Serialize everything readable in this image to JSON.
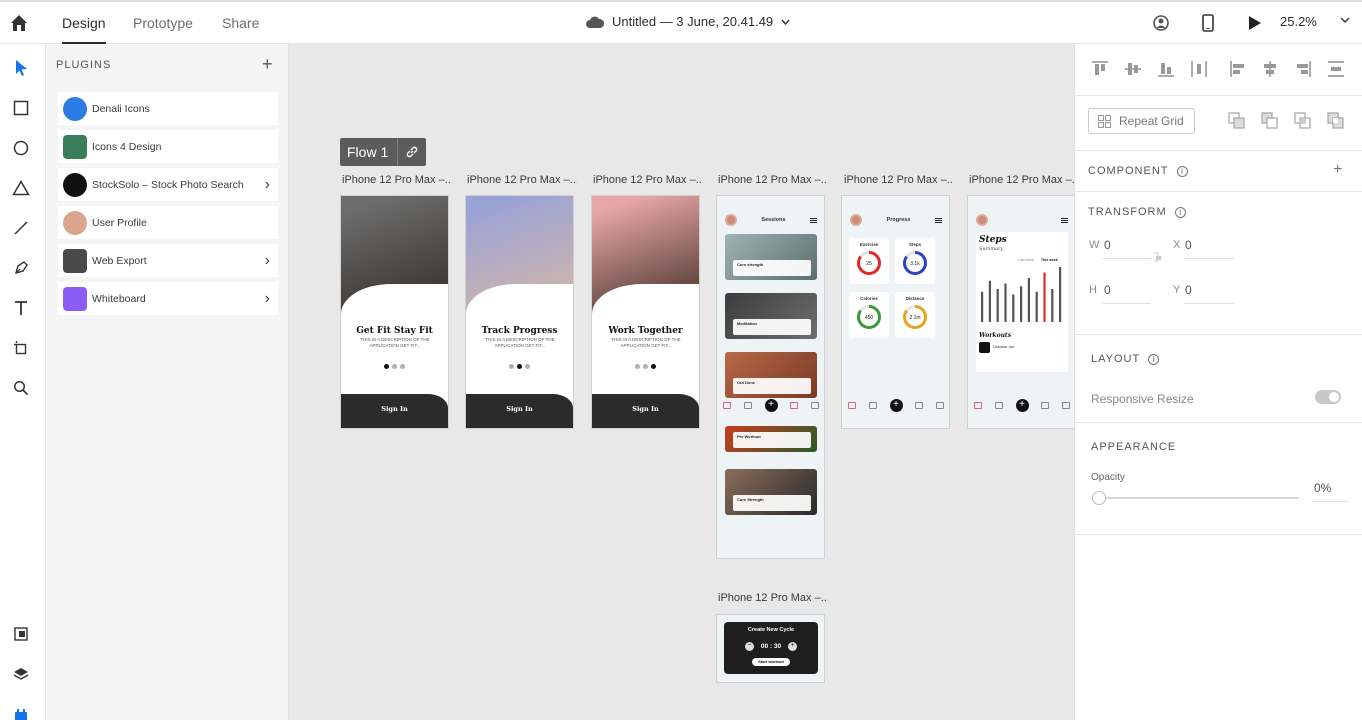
{
  "topbar": {
    "tabs": [
      {
        "label": "Design",
        "active": true
      },
      {
        "label": "Prototype",
        "active": false
      },
      {
        "label": "Share",
        "active": false
      }
    ],
    "doc_title": "Untitled — 3 June, 20.41.49",
    "zoom": "25.2%"
  },
  "plugins": {
    "title": "PLUGINS",
    "items": [
      {
        "name": "Denali Icons",
        "icon_color": "#2d7be5",
        "has_chevron": false
      },
      {
        "name": "Icons 4 Design",
        "icon_color": "#3a7f5a",
        "has_chevron": false
      },
      {
        "name": "StockSolo – Stock Photo Search",
        "icon_color": "#111111",
        "has_chevron": true
      },
      {
        "name": "User Profile",
        "icon_color": "#d9a58d",
        "has_chevron": false
      },
      {
        "name": "Web Export",
        "icon_color": "#4a4a4a",
        "has_chevron": true
      },
      {
        "name": "Whiteboard",
        "icon_color": "#8b5cf6",
        "has_chevron": true
      }
    ]
  },
  "canvas": {
    "flow_label": "Flow 1",
    "artboard_label": "iPhone 12 Pro Max –...",
    "artboard_label_last": "iPhone 12 Pro Max –...",
    "onboarding": [
      {
        "title": "Get Fit Stay Fit",
        "desc": "THIS IS A DESCRIPTION OF THE APPLICATION GET FIT...",
        "button": "Sign In",
        "active_dot": 0,
        "photo_colors": [
          "#6d6d6d",
          "#2f2a26"
        ]
      },
      {
        "title": "Track Progress",
        "desc": "THIS IS A DESCRIPTION OF THE APPLICATION GET FIT...",
        "button": "Sign In",
        "active_dot": 1,
        "photo_colors": [
          "#9aa3d6",
          "#d8b8a4"
        ]
      },
      {
        "title": "Work Together",
        "desc": "THIS IS A DESCRIPTION OF THE APPLICATION GET FIT...",
        "button": "Sign In",
        "active_dot": 2,
        "photo_colors": [
          "#e8a7a7",
          "#3a2a22"
        ]
      }
    ],
    "sessions": {
      "title": "Sessions",
      "items": [
        {
          "name": "Core strength",
          "colors": [
            "#9fb3b5",
            "#5b6e70"
          ]
        },
        {
          "name": "Meditation",
          "colors": [
            "#3c3c3c",
            "#6e6e6e"
          ]
        },
        {
          "name": "Out Done",
          "colors": [
            "#b86848",
            "#7a3a26"
          ]
        },
        {
          "name": "Pre Workout",
          "colors": [
            "#c83e1e",
            "#2a5a2a"
          ]
        },
        {
          "name": "Core Strength",
          "colors": [
            "#8a6e5a",
            "#2a2a2a"
          ]
        }
      ]
    },
    "progress": {
      "title": "Progress",
      "cards": [
        {
          "label": "Exercise",
          "value": "25",
          "color": "#e02a2a"
        },
        {
          "label": "Steps",
          "value": "3.1k",
          "color": "#2a44c8"
        },
        {
          "label": "Calories",
          "value": "450",
          "color": "#3a9a3a"
        },
        {
          "label": "Distance",
          "value": "2.1m",
          "color": "#e8a21e"
        }
      ]
    },
    "steps": {
      "title": "Steps",
      "subtitle": "Summary",
      "legend_last": "Last week",
      "legend_this": "This week",
      "bars": [
        0.55,
        0.75,
        0.6,
        0.7,
        0.5,
        0.65,
        0.8,
        0.55,
        0.9,
        0.6,
        1.0
      ],
      "highlight_index": 8,
      "workouts_title": "Workouts",
      "workout_item": "Outdoor run"
    },
    "create_cycle": {
      "title": "Create New Cycle",
      "time": "00 : 30",
      "button": "Start workout"
    }
  },
  "props": {
    "repeat_grid": "Repeat Grid",
    "component": "COMPONENT",
    "transform": "TRANSFORM",
    "w_label": "W",
    "w_value": "0",
    "h_label": "H",
    "h_value": "0",
    "x_label": "X",
    "x_value": "0",
    "y_label": "Y",
    "y_value": "0",
    "layout": "LAYOUT",
    "responsive": "Responsive Resize",
    "appearance": "APPEARANCE",
    "opacity_label": "Opacity",
    "opacity_value": "0%"
  }
}
